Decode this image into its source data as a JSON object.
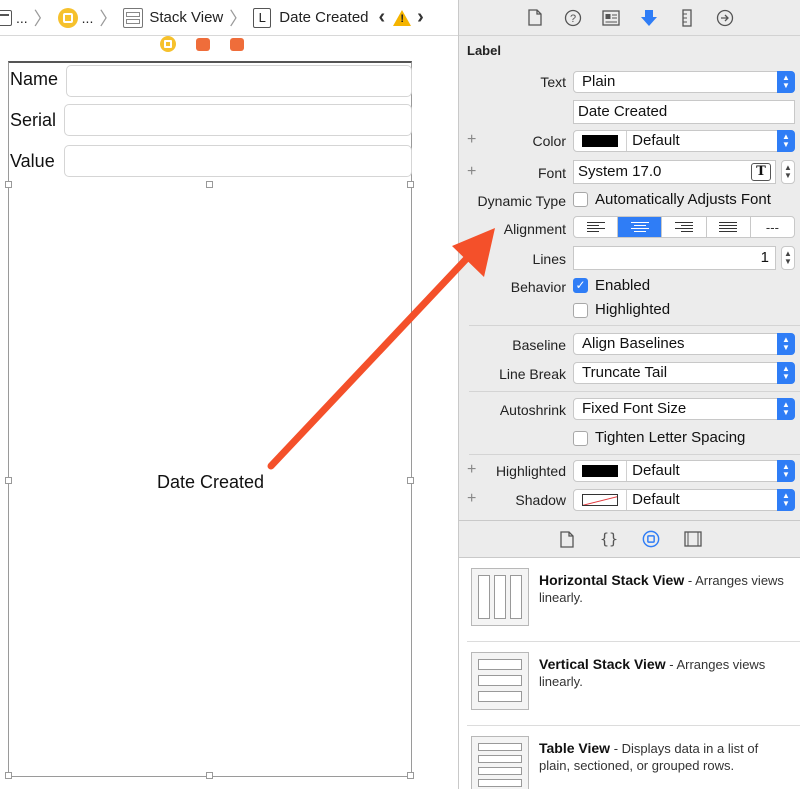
{
  "jumpbar": {
    "item1_label": "...",
    "item2_label": "...",
    "stack_view_label": "Stack View",
    "date_created_label": "Date Created",
    "label_icon_letter": "L",
    "warning_glyph": "!"
  },
  "canvas": {
    "fields": [
      {
        "label": "Name"
      },
      {
        "label": "Serial"
      },
      {
        "label": "Value"
      }
    ],
    "date_label": "Date Created"
  },
  "inspector": {
    "section_title": "Label",
    "text": {
      "label": "Text",
      "value": "Plain",
      "content": "Date Created"
    },
    "color": {
      "label": "Color",
      "value": "Default",
      "swatch": "#000000"
    },
    "font": {
      "label": "Font",
      "value": "System 17.0",
      "font_icon": "T"
    },
    "dynamic_type": {
      "label": "Dynamic Type",
      "checkbox_label": "Automatically Adjusts Font",
      "checked": false
    },
    "alignment": {
      "label": "Alignment",
      "options": [
        "left",
        "center",
        "right",
        "justified",
        "natural"
      ],
      "selected": "center",
      "natural_glyph": "---"
    },
    "lines": {
      "label": "Lines",
      "value": "1"
    },
    "behavior": {
      "label": "Behavior",
      "enabled_label": "Enabled",
      "enabled": true,
      "highlighted_label": "Highlighted",
      "highlighted": false
    },
    "baseline": {
      "label": "Baseline",
      "value": "Align Baselines"
    },
    "line_break": {
      "label": "Line Break",
      "value": "Truncate Tail"
    },
    "autoshrink": {
      "label": "Autoshrink",
      "value": "Fixed Font Size",
      "tighten_label": "Tighten Letter Spacing",
      "tighten": false
    },
    "highlighted_color": {
      "label": "Highlighted",
      "value": "Default",
      "swatch": "#000000"
    },
    "shadow": {
      "label": "Shadow",
      "value": "Default"
    },
    "plus_glyph": "+",
    "accent": "#2f7df6"
  },
  "library": {
    "items": [
      {
        "title": "Horizontal Stack View",
        "desc": " - Arranges views linearly."
      },
      {
        "title": "Vertical Stack View",
        "desc": " - Arranges views linearly."
      },
      {
        "title": "Table View",
        "desc": " - Displays data in a list of plain, sectioned, or grouped rows."
      }
    ]
  },
  "annotation": {
    "arrow_color": "#f4502a"
  }
}
